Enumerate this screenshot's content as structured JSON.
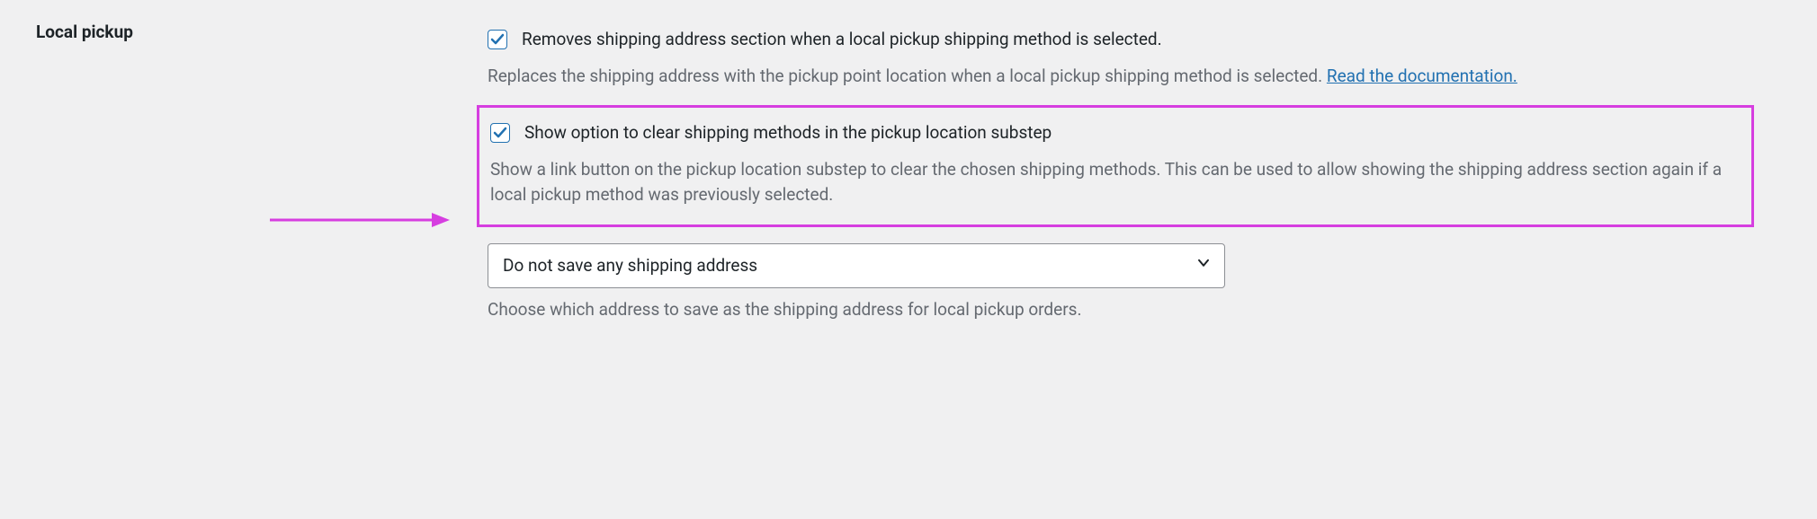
{
  "section": {
    "label": "Local pickup"
  },
  "options": {
    "remove_shipping": {
      "label": "Removes shipping address section when a local pickup shipping method is selected.",
      "description": "Replaces the shipping address with the pickup point location when a local pickup shipping method is selected. ",
      "doc_link": "Read the documentation."
    },
    "show_clear_option": {
      "label": "Show option to clear shipping methods in the pickup location substep",
      "description": "Show a link button on the pickup location substep to clear the chosen shipping methods. This can be used to allow showing the shipping address section again if a local pickup method was previously selected."
    },
    "save_address": {
      "selected": "Do not save any shipping address",
      "description": "Choose which address to save as the shipping address for local pickup orders."
    }
  }
}
